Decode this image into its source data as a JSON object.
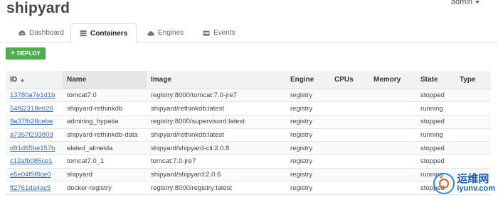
{
  "app": {
    "title": "shipyard",
    "user": "admin"
  },
  "tabs": [
    {
      "label": "Dashboard",
      "icon": "dashboard-icon",
      "active": false
    },
    {
      "label": "Containers",
      "icon": "containers-icon",
      "active": true
    },
    {
      "label": "Engines",
      "icon": "cloud-icon",
      "active": false
    },
    {
      "label": "Events",
      "icon": "list-icon",
      "active": false
    }
  ],
  "deploy_button": {
    "label": "DEPLOY",
    "color": "#4caf50"
  },
  "table": {
    "columns": [
      "ID",
      "Name",
      "Image",
      "Engine",
      "CPUs",
      "Memory",
      "State",
      "Type"
    ],
    "sort_indicator": "▲",
    "rows": [
      {
        "id": "13780a7e1d1b",
        "name": "tomcat7.0",
        "image": "registry:8000/tomcat:7.0-jre7",
        "engine": "registry",
        "cpus": "",
        "memory": "",
        "state": "stopped",
        "type": ""
      },
      {
        "id": "54f62318eb26",
        "name": "shipyard-rethinkdb",
        "image": "shipyard/rethinkdb:latest",
        "engine": "registry",
        "cpus": "",
        "memory": "",
        "state": "running",
        "type": ""
      },
      {
        "id": "9a37fb26cebe",
        "name": "admiring_hypatia",
        "image": "registry:8000/supervisord:latest",
        "engine": "registry",
        "cpus": "",
        "memory": "",
        "state": "stopped",
        "type": ""
      },
      {
        "id": "a7357f293803",
        "name": "shipyard-rethinkdb-data",
        "image": "shipyard/rethinkdb:latest",
        "engine": "registry",
        "cpus": "",
        "memory": "",
        "state": "running",
        "type": ""
      },
      {
        "id": "d91d65be157b",
        "name": "elated_almeida",
        "image": "shipyard/shipyard-cli:2.0.8",
        "engine": "registry",
        "cpus": "",
        "memory": "",
        "state": "stopped",
        "type": ""
      },
      {
        "id": "c12afb085ce1",
        "name": "tomcat7.0_1",
        "image": "tomcat:7.0-jre7",
        "engine": "registry",
        "cpus": "",
        "memory": "",
        "state": "stopped",
        "type": ""
      },
      {
        "id": "e5e04f9f8ce0",
        "name": "shipyard",
        "image": "shipyard/shipyard:2.0.6",
        "engine": "registry",
        "cpus": "",
        "memory": "",
        "state": "running",
        "type": ""
      },
      {
        "id": "ff2761da4ac5",
        "name": "docker-registry",
        "image": "registry:8000/registry:latest",
        "engine": "registry",
        "cpus": "",
        "memory": "",
        "state": "stopped",
        "type": ""
      }
    ]
  },
  "watermark": {
    "cn": "运维网",
    "en": "iyunv.com"
  }
}
